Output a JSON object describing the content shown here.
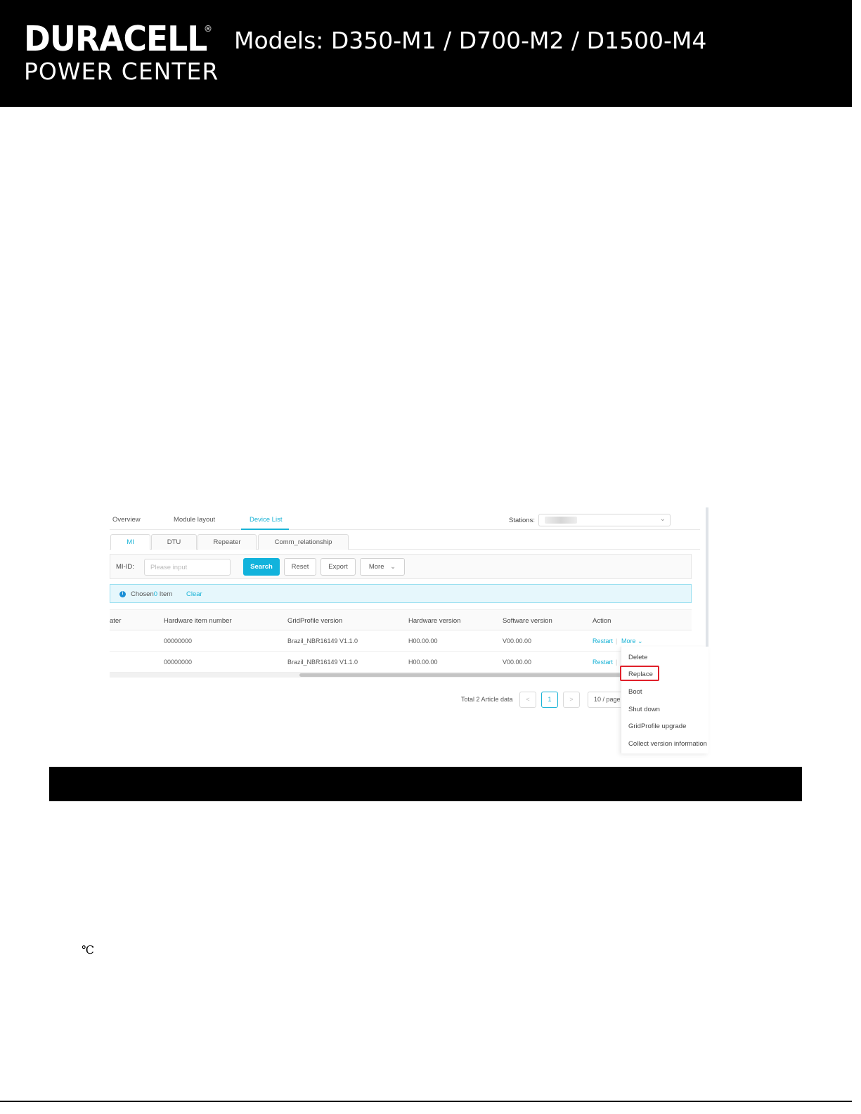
{
  "header": {
    "brand_name": "DURACELL",
    "brand_reg": "®",
    "brand_sub": "POWER CENTER",
    "models_text": "Models: D350-M1 / D700-M2 / D1500-M4"
  },
  "screenshot": {
    "top_tabs": [
      "Overview",
      "Module layout",
      "Device List"
    ],
    "active_top_tab": "Device List",
    "stations_label": "Stations:",
    "sub_tabs": [
      "MI",
      "DTU",
      "Repeater",
      "Comm_relationship"
    ],
    "active_sub_tab": "MI",
    "filter": {
      "label": "MI-ID:",
      "placeholder": "Please input",
      "search_label": "Search",
      "reset_label": "Reset",
      "export_label": "Export",
      "more_label": "More"
    },
    "notice": {
      "prefix": "Chosen",
      "count": "0",
      "suffix": "Item",
      "clear_label": "Clear"
    },
    "table": {
      "headers": [
        "ater",
        "Hardware item number",
        "GridProfile version",
        "Hardware version",
        "Software version",
        "Action"
      ],
      "rows": [
        {
          "hw_item": "00000000",
          "grid_profile": "Brazil_NBR16149 V1.1.0",
          "hw_version": "H00.00.00",
          "sw_version": "V00.00.00",
          "restart": "Restart",
          "sep": "|",
          "more": "More"
        },
        {
          "hw_item": "00000000",
          "grid_profile": "Brazil_NBR16149 V1.1.0",
          "hw_version": "H00.00.00",
          "sw_version": "V00.00.00",
          "restart": "Restart",
          "sep": "|"
        }
      ]
    },
    "pagination": {
      "total_text": "Total 2 Article data",
      "prev": "<",
      "current_page": "1",
      "next": ">",
      "page_size": "10 / page"
    },
    "more_menu": {
      "items": [
        "Delete",
        "Replace",
        "Boot",
        "Shut down",
        "GridProfile upgrade",
        "Collect version information"
      ],
      "highlighted": "Replace"
    }
  },
  "body": {
    "degree_symbol": "℃"
  },
  "colors": {
    "accent": "#1ab3d6",
    "highlight_box": "#e0202a",
    "banner": "#000000"
  }
}
